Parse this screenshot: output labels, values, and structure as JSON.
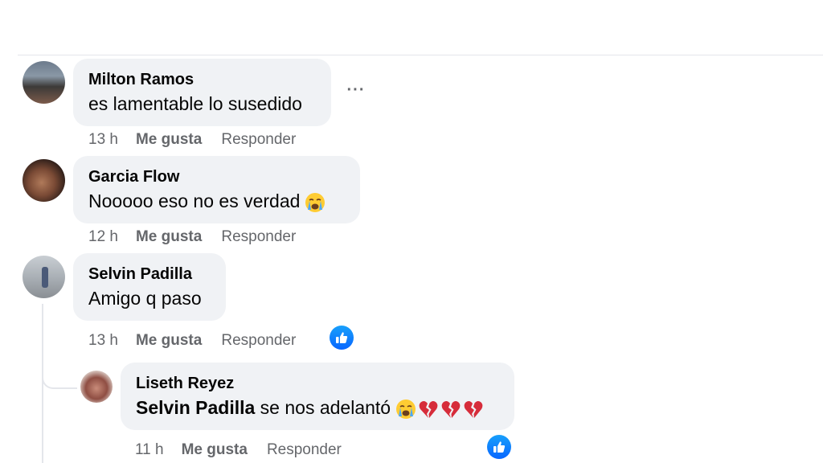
{
  "comments": [
    {
      "author": "Milton Ramos",
      "text": "es lamentable lo susedido",
      "time": "13 h",
      "like": "Me gusta",
      "reply": "Responder",
      "more": "···",
      "avatar_icon": "user-photo"
    },
    {
      "author": "Garcia Flow",
      "text": "Nooooo eso no es verdad",
      "emoji": "loudly-crying-face",
      "time": "12 h",
      "like": "Me gusta",
      "reply": "Responder",
      "avatar_icon": "user-photo"
    },
    {
      "author": "Selvin Padilla",
      "text": "Amigo q paso",
      "time": "13 h",
      "like": "Me gusta",
      "reply": "Responder",
      "reaction_icon": "like-reaction-icon",
      "avatar_icon": "user-photo"
    }
  ],
  "reply": {
    "author": "Liseth Reyez",
    "mention": "Selvin Padilla",
    "text": " se nos adelantó",
    "emojis": [
      "loudly-crying-face",
      "broken-heart",
      "broken-heart",
      "broken-heart"
    ],
    "time": "11 h",
    "like": "Me gusta",
    "reply": "Responder",
    "reaction_icon": "like-reaction-icon",
    "avatar_icon": "user-photo"
  },
  "colors": {
    "bubble": "#f0f2f5",
    "meta_text": "#65676b",
    "like_blue": "#0866ff",
    "thread_line": "#e4e6eb"
  }
}
